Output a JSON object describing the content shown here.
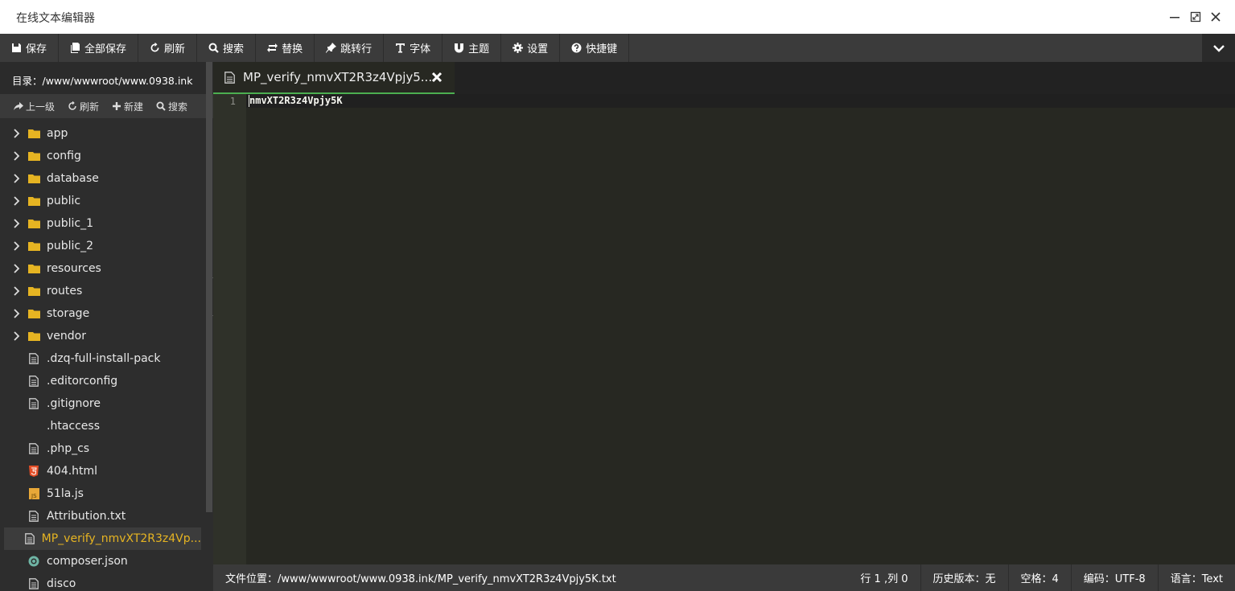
{
  "window": {
    "title": "在线文本编辑器"
  },
  "toolbar": {
    "items": [
      {
        "label": "保存",
        "icon": "save-icon"
      },
      {
        "label": "全部保存",
        "icon": "save-all-icon"
      },
      {
        "label": "刷新",
        "icon": "refresh-icon"
      },
      {
        "label": "搜索",
        "icon": "search-icon"
      },
      {
        "label": "替换",
        "icon": "replace-icon"
      },
      {
        "label": "跳转行",
        "icon": "pin-icon"
      },
      {
        "label": "字体",
        "icon": "font-icon"
      },
      {
        "label": "主题",
        "icon": "magnet-icon"
      },
      {
        "label": "设置",
        "icon": "gear-icon"
      },
      {
        "label": "快捷键",
        "icon": "help-icon"
      }
    ]
  },
  "sidebar": {
    "directory": "目录：/www/wwwroot/www.0938.ink",
    "actions": [
      {
        "label": "上一级",
        "icon": "share-icon"
      },
      {
        "label": "刷新",
        "icon": "refresh-icon"
      },
      {
        "label": "新建",
        "icon": "plus-icon"
      },
      {
        "label": "搜索",
        "icon": "search-icon"
      }
    ],
    "items": [
      {
        "name": "app",
        "type": "folder"
      },
      {
        "name": "config",
        "type": "folder"
      },
      {
        "name": "database",
        "type": "folder"
      },
      {
        "name": "public",
        "type": "folder"
      },
      {
        "name": "public_1",
        "type": "folder"
      },
      {
        "name": "public_2",
        "type": "folder"
      },
      {
        "name": "resources",
        "type": "folder"
      },
      {
        "name": "routes",
        "type": "folder"
      },
      {
        "name": "storage",
        "type": "folder"
      },
      {
        "name": "vendor",
        "type": "folder"
      },
      {
        "name": ".dzq-full-install-pack",
        "type": "file"
      },
      {
        "name": ".editorconfig",
        "type": "file"
      },
      {
        "name": ".gitignore",
        "type": "file"
      },
      {
        "name": ".htaccess",
        "type": "blank"
      },
      {
        "name": ".php_cs",
        "type": "file"
      },
      {
        "name": "404.html",
        "type": "html"
      },
      {
        "name": "51la.js",
        "type": "js"
      },
      {
        "name": "Attribution.txt",
        "type": "file"
      },
      {
        "name": "MP_verify_nmvXT2R3z4Vp...",
        "type": "file",
        "active": true
      },
      {
        "name": "composer.json",
        "type": "json"
      },
      {
        "name": "disco",
        "type": "file"
      }
    ]
  },
  "editor": {
    "tab_title": "MP_verify_nmvXT2R3z4Vpjy5...",
    "line_number": "1",
    "content": "nmvXT2R3z4Vpjy5K"
  },
  "status": {
    "path": "文件位置：/www/wwwroot/www.0938.ink/MP_verify_nmvXT2R3z4Vpjy5K.txt",
    "position": "行 1 ,列 0",
    "history": "历史版本：无",
    "indent": "空格：4",
    "encoding": "编码：UTF-8",
    "language": "语言：Text"
  },
  "colors": {
    "accent_green": "#4caf50",
    "active_file": "#e6b422",
    "folder": "#e6b422",
    "editor_bg": "#272822"
  }
}
